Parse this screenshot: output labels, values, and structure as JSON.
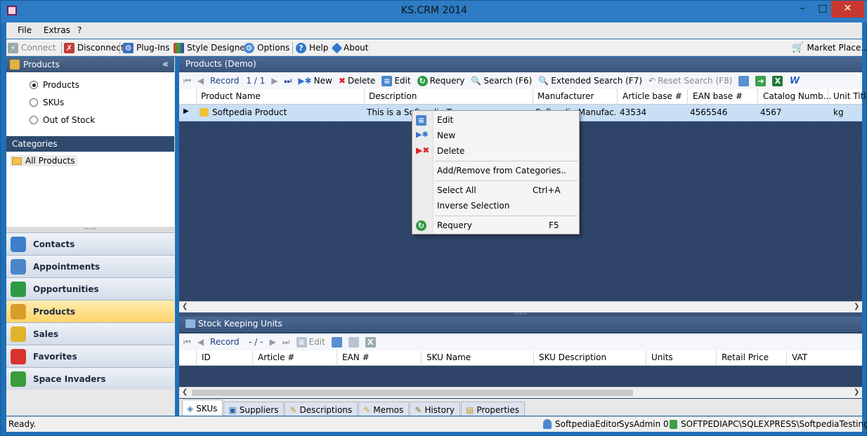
{
  "window": {
    "title": "KS.CRM 2014",
    "minimize": "–",
    "maximize": "□",
    "close": "✕"
  },
  "menubar": [
    "File",
    "Extras",
    "?"
  ],
  "toolbar": {
    "connect": "Connect",
    "disconnect": "Disconnect",
    "plugins": "Plug-Ins",
    "style_designer": "Style Designer",
    "options": "Options",
    "help": "Help",
    "about": "About",
    "market_place": "Market Place.."
  },
  "left": {
    "products_header": "Products",
    "collapse": "«",
    "radios": [
      "Products",
      "SKUs",
      "Out of Stock"
    ],
    "selected_radio": "Products",
    "categories_header": "Categories",
    "category_item": "All Products",
    "nav": [
      {
        "label": "Contacts",
        "icon": "contacts-icon",
        "color": "#3d7fc9"
      },
      {
        "label": "Appointments",
        "icon": "calendar-icon",
        "color": "#4a86c8"
      },
      {
        "label": "Opportunities",
        "icon": "opportunities-icon",
        "color": "#2f9a45"
      },
      {
        "label": "Products",
        "icon": "products-icon",
        "color": "#d99d2a"
      },
      {
        "label": "Sales",
        "icon": "sales-icon",
        "color": "#e0b32c"
      },
      {
        "label": "Favorites",
        "icon": "heart-icon",
        "color": "#d8322e"
      },
      {
        "label": "Space Invaders",
        "icon": "invader-icon",
        "color": "#3a9b3a"
      }
    ],
    "selected_nav": "Products"
  },
  "products": {
    "header": "Products (Demo)",
    "toolbar": {
      "record_label": "Record",
      "record_value": "1 / 1",
      "new": "New",
      "delete": "Delete",
      "edit": "Edit",
      "requery": "Requery",
      "search": "Search (F6)",
      "extended_search": "Extended Search (F7)",
      "reset_search": "Reset Search (F8)"
    },
    "columns": [
      "Product Name",
      "Description",
      "Manufacturer",
      "Article base #",
      "EAN base #",
      "Catalog Numb...",
      "Unit Titl"
    ],
    "rows": [
      {
        "name": "Softpedia Product",
        "description": "This is a Softpedia Te",
        "manufacturer": "Softpedia Manufac...",
        "article": "43534",
        "ean": "4565546",
        "catalog": "4567",
        "unit": "kg"
      }
    ]
  },
  "context_menu": {
    "items": [
      {
        "label": "Edit",
        "shortcut": ""
      },
      {
        "label": "New",
        "shortcut": ""
      },
      {
        "label": "Delete",
        "shortcut": ""
      },
      {
        "label": "Add/Remove from Categories..",
        "shortcut": ""
      },
      {
        "label": "Select All",
        "shortcut": "Ctrl+A"
      },
      {
        "label": "Inverse Selection",
        "shortcut": ""
      },
      {
        "label": "Requery",
        "shortcut": "F5"
      }
    ]
  },
  "sku": {
    "header": "Stock Keeping Units",
    "toolbar": {
      "record_label": "Record",
      "record_value": "- / -",
      "edit": "Edit"
    },
    "columns": [
      "ID",
      "Article #",
      "EAN #",
      "SKU Name",
      "SKU Description",
      "Units",
      "Retail Price",
      "VAT"
    ]
  },
  "tabs": [
    "SKUs",
    "Suppliers",
    "Descriptions",
    "Memos",
    "History",
    "Properties"
  ],
  "selected_tab": "SKUs",
  "status": {
    "left": "Ready.",
    "user": "SoftpediaEditor",
    "sysadmin": "SysAdmin 0",
    "server": "SOFTPEDIAPC\\SQLEXPRESS\\SoftpediaTesting"
  }
}
